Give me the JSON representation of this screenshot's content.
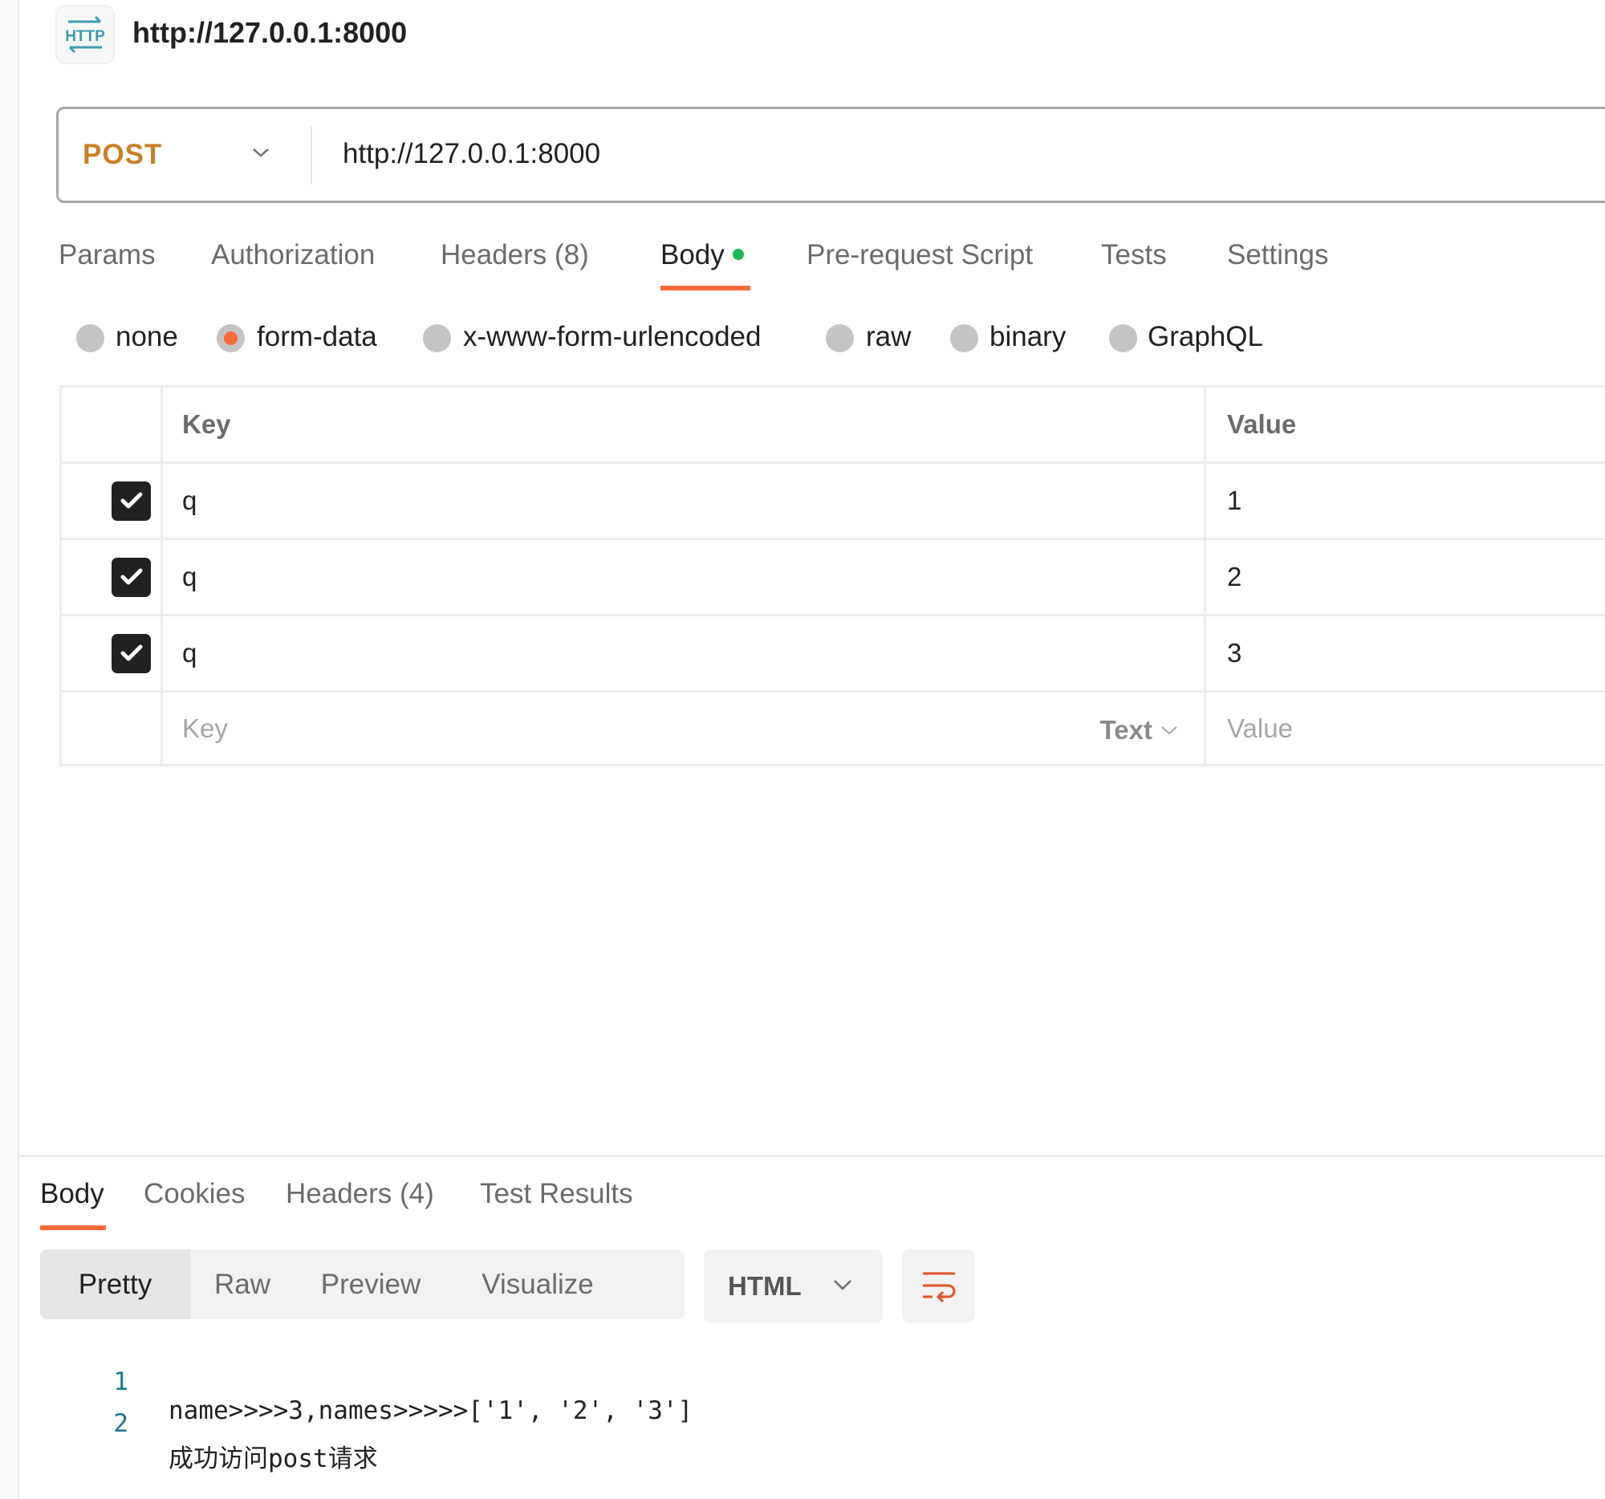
{
  "header": {
    "icon": "http-icon",
    "title": "http://127.0.0.1:8000"
  },
  "url_bar": {
    "method": "POST",
    "method_color": "#c97f25",
    "url": "http://127.0.0.1:8000"
  },
  "request_tabs": [
    {
      "label": "Params",
      "active": false
    },
    {
      "label": "Authorization",
      "active": false
    },
    {
      "label": "Headers (8)",
      "active": false
    },
    {
      "label": "Body",
      "active": true,
      "indicator": "green-dot"
    },
    {
      "label": "Pre-request Script",
      "active": false
    },
    {
      "label": "Tests",
      "active": false
    },
    {
      "label": "Settings",
      "active": false
    }
  ],
  "body_types": [
    {
      "label": "none",
      "selected": false
    },
    {
      "label": "form-data",
      "selected": true
    },
    {
      "label": "x-www-form-urlencoded",
      "selected": false
    },
    {
      "label": "raw",
      "selected": false
    },
    {
      "label": "binary",
      "selected": false
    },
    {
      "label": "GraphQL",
      "selected": false
    }
  ],
  "form_table": {
    "headers": {
      "key": "Key",
      "value": "Value"
    },
    "rows": [
      {
        "checked": true,
        "key": "q",
        "value": "1"
      },
      {
        "checked": true,
        "key": "q",
        "value": "2"
      },
      {
        "checked": true,
        "key": "q",
        "value": "3"
      }
    ],
    "new_row": {
      "key_placeholder": "Key",
      "type": "Text",
      "value_placeholder": "Value"
    }
  },
  "response_tabs": [
    {
      "label": "Body",
      "active": true
    },
    {
      "label": "Cookies",
      "active": false
    },
    {
      "label": "Headers (4)",
      "active": false
    },
    {
      "label": "Test Results",
      "active": false
    }
  ],
  "response_view": {
    "modes": [
      {
        "label": "Pretty",
        "active": true
      },
      {
        "label": "Raw",
        "active": false
      },
      {
        "label": "Preview",
        "active": false
      },
      {
        "label": "Visualize",
        "active": false
      }
    ],
    "language": "HTML",
    "wrap_icon": "wrap-lines-icon"
  },
  "response_body": [
    {
      "line": "1",
      "text": "name>>>>3,names>>>>>['1', '2', '3']"
    },
    {
      "line": "2",
      "text": "成功访问post请求"
    }
  ],
  "colors": {
    "accent": "#ff6c37",
    "body_indicator": "#1db954",
    "line_number": "#1f7890"
  }
}
